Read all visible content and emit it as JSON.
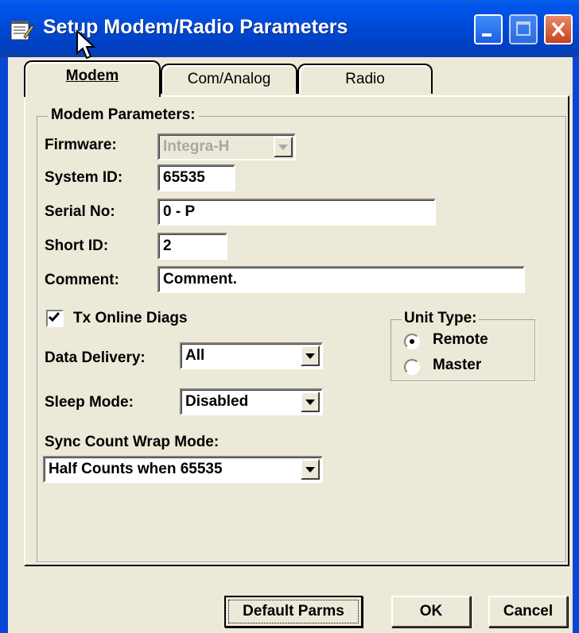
{
  "window": {
    "title": "Setup Modem/Radio Parameters",
    "icon": "notepad-icon"
  },
  "tabs": [
    {
      "label": "Modem",
      "active": true
    },
    {
      "label": "Com/Analog",
      "active": false
    },
    {
      "label": "Radio",
      "active": false
    }
  ],
  "modem_group": {
    "title": "Modem Parameters:",
    "firmware": {
      "label": "Firmware:",
      "value": "Integra-H",
      "disabled": true
    },
    "system_id": {
      "label": "System ID:",
      "value": "65535"
    },
    "serial_no": {
      "label": "Serial No:",
      "value": "0 - P"
    },
    "short_id": {
      "label": "Short ID:",
      "value": "2"
    },
    "comment": {
      "label": "Comment:",
      "value": "Comment."
    },
    "tx_online_diags": {
      "label": "Tx Online Diags",
      "checked": true
    },
    "data_delivery": {
      "label": "Data Delivery:",
      "value": "All"
    },
    "sleep_mode": {
      "label": "Sleep Mode:",
      "value": "Disabled"
    },
    "sync_count": {
      "label": "Sync Count Wrap Mode:",
      "value": "Half Counts when 65535"
    },
    "unit_type": {
      "label": "Unit Type:",
      "options": [
        {
          "label": "Remote",
          "selected": true
        },
        {
          "label": "Master",
          "selected": false
        }
      ]
    }
  },
  "buttons": {
    "default": "Default Parms",
    "ok": "OK",
    "cancel": "Cancel"
  },
  "colors": {
    "titlebar": "#0049D4",
    "face": "#ECE9D8",
    "close": "#C8421E"
  }
}
